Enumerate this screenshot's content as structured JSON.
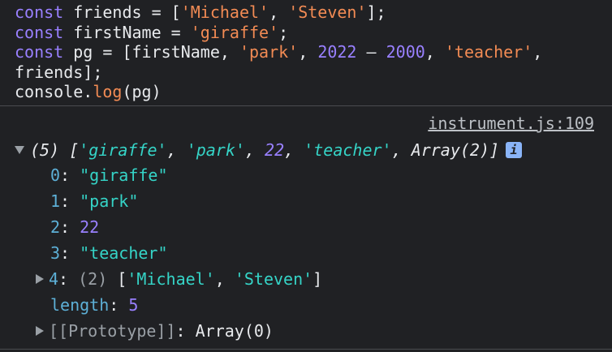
{
  "code": {
    "line1": {
      "kw": "const",
      "rest": " friends = [",
      "s1": "'Michael'",
      "sep": ", ",
      "s2": "'Steven'",
      "end": "];"
    },
    "line2": {
      "kw": "const",
      "rest": " firstName = ",
      "s1": "'giraffe'",
      "end": ";"
    },
    "line3": {
      "kw": "const",
      "rest": " pg = [firstName, ",
      "s1": "'park'",
      "sep": ", ",
      "n1": "2022",
      "op": " – ",
      "n2": "2000",
      "sep2": ", ",
      "s2": "'teacher'",
      "end": ","
    },
    "line4": {
      "text": "friends];"
    },
    "line5": {
      "obj": "console.",
      "fn": "log",
      "args": "(pg)"
    }
  },
  "output": {
    "source_link": "instrument.js:109",
    "summary": {
      "count": "(5) [",
      "v0": "'giraffe'",
      "v1": "'park'",
      "v2": "22",
      "v3": "'teacher'",
      "v4": "Array(2)",
      "close": "]",
      "info": "i"
    },
    "props": [
      {
        "key": "0",
        "value": "\"giraffe\""
      },
      {
        "key": "1",
        "value": "\"park\""
      },
      {
        "key": "2",
        "value": "22"
      },
      {
        "key": "3",
        "value": "\"teacher\""
      }
    ],
    "prop4": {
      "key": "4",
      "len": "(2)",
      "open": " [",
      "s1": "'Michael'",
      "sep": ", ",
      "s2": "'Steven'",
      "close": "]"
    },
    "length": {
      "key": "length",
      "value": "5"
    },
    "prototype": {
      "key": "[[Prototype]]",
      "value": "Array(0)"
    }
  }
}
